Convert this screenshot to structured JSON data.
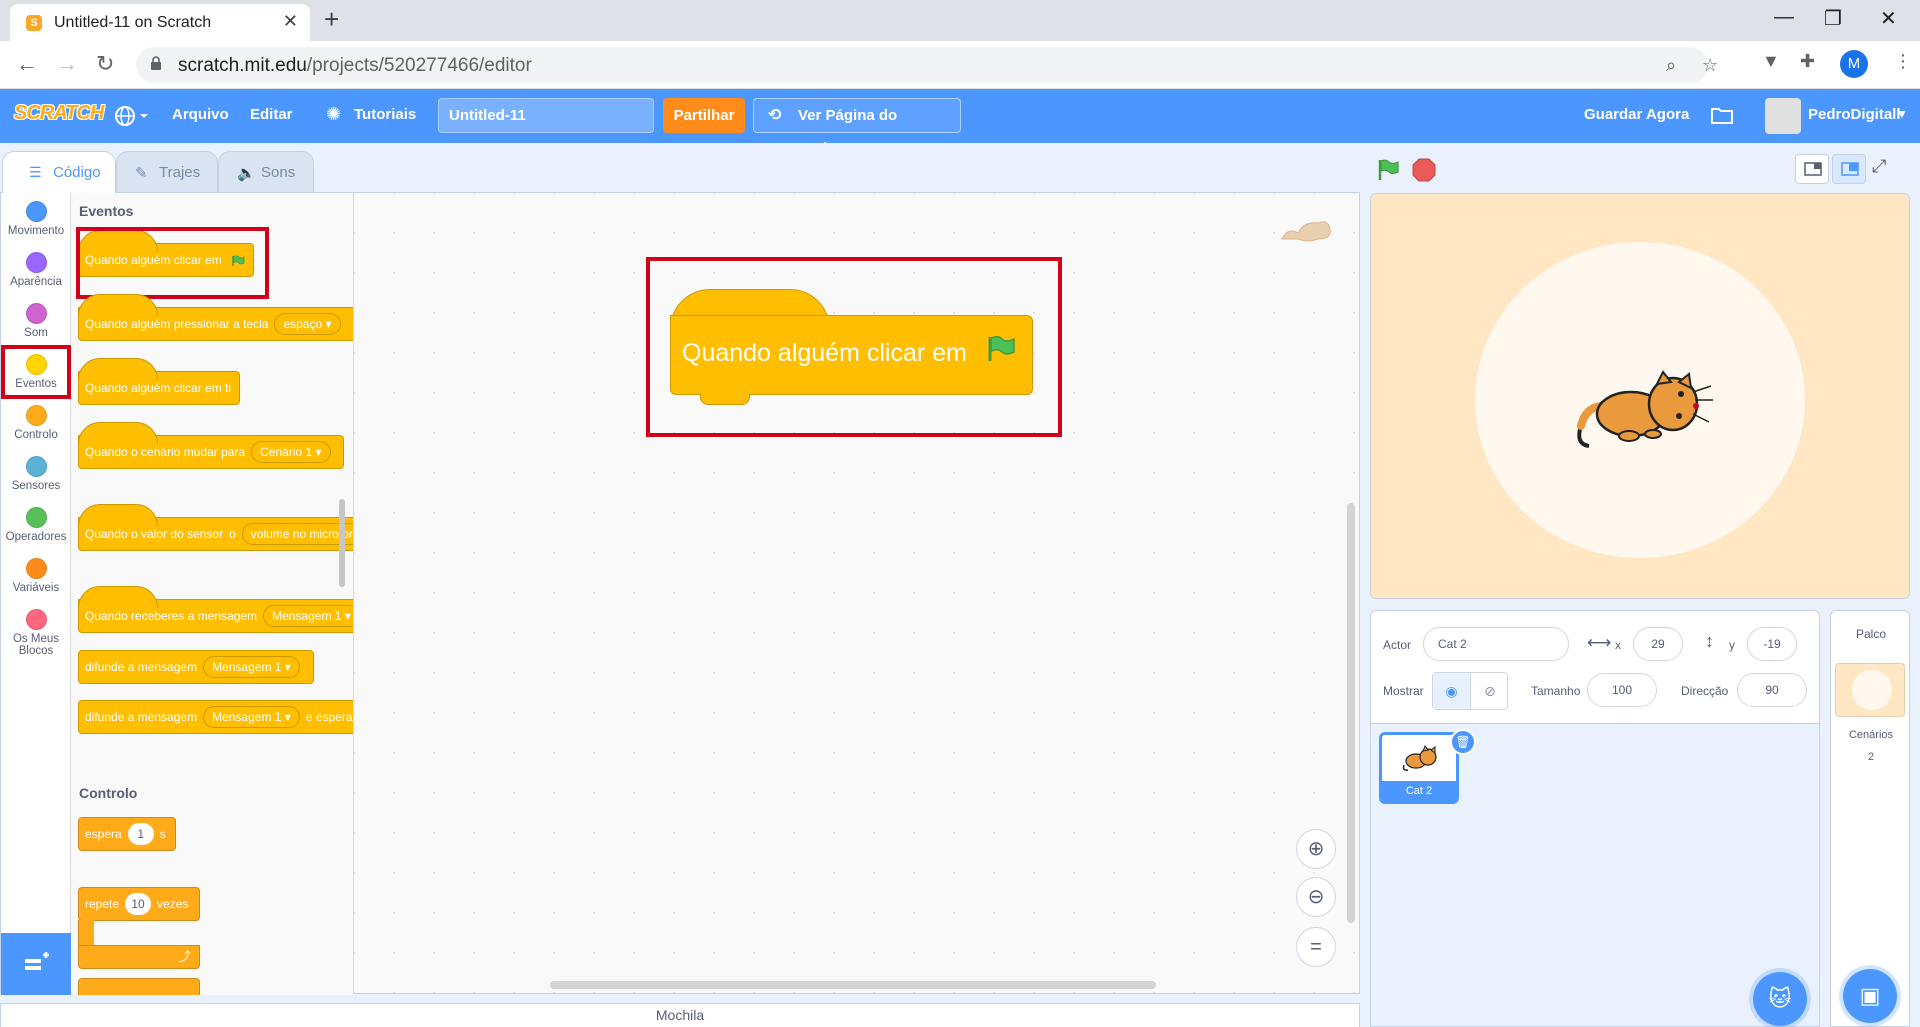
{
  "browser": {
    "tab_title": "Untitled-11 on Scratch",
    "url_host": "scratch.mit.edu",
    "url_path": "/projects/520277466/editor",
    "profile_initial": "M"
  },
  "menubar": {
    "logo": "SCRATCH",
    "file": "Arquivo",
    "edit": "Editar",
    "tutorials": "Tutoriais",
    "project_title": "Untitled-11",
    "share": "Partilhar",
    "see_project_page": "Ver Página do Projecto",
    "save_now": "Guardar Agora",
    "username": "PedroDigitall"
  },
  "editor_tabs": [
    "Código",
    "Trajes",
    "Sons"
  ],
  "categories": [
    {
      "label": "Movimento",
      "color": "#4c97ff"
    },
    {
      "label": "Aparência",
      "color": "#9966ff"
    },
    {
      "label": "Som",
      "color": "#cf63cf"
    },
    {
      "label": "Eventos",
      "color": "#ffd500"
    },
    {
      "label": "Controlo",
      "color": "#ffab19"
    },
    {
      "label": "Sensores",
      "color": "#5cb1d6"
    },
    {
      "label": "Operadores",
      "color": "#59c059"
    },
    {
      "label": "Variáveis",
      "color": "#ff8c1a"
    },
    {
      "label": "Os Meus Blocos",
      "color": "#ff6680"
    }
  ],
  "flyout": {
    "events_heading": "Eventos",
    "control_heading": "Controlo",
    "blocks": {
      "when_flag": "Quando alguém clicar em",
      "when_key": "Quando alguém pressionar a tecla",
      "key_value": "espaço",
      "when_clicked": "Quando alguém clicar em ti",
      "when_backdrop": "Quando o cenário mudar para",
      "backdrop_value": "Cenário 1",
      "when_sensor": "Quando o valor do sensor",
      "sensor_value": "volume no microfone",
      "when_receive": "Quando receberes a mensagem",
      "message_value": "Mensagem 1",
      "broadcast": "difunde a mensagem",
      "broadcast_wait": "difunde a mensagem",
      "broadcast_wait_suffix": "e espera",
      "wait": "espera",
      "wait_value": "1",
      "wait_unit": "s",
      "repeat": "repete",
      "repeat_value": "10",
      "repeat_unit": "vezes"
    }
  },
  "script": {
    "block_text": "Quando alguém clicar em"
  },
  "backpack": "Mochila",
  "sprite_info": {
    "sprite_label": "Actor",
    "sprite_name": "Cat 2",
    "x_label": "x",
    "x_value": "29",
    "y_label": "y",
    "y_value": "-19",
    "show_label": "Mostrar",
    "size_label": "Tamanho",
    "size_value": "100",
    "direction_label": "Direcção",
    "direction_value": "90"
  },
  "sprites": [
    {
      "name": "Cat 2"
    }
  ],
  "stage_pane": {
    "title": "Palco",
    "backdrops_label": "Cenários",
    "backdrops_count": "2"
  }
}
